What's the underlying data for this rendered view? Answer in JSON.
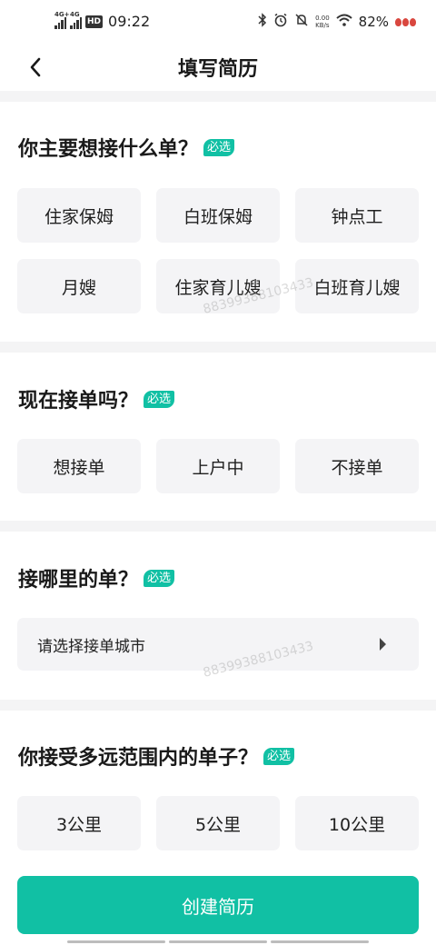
{
  "status_bar": {
    "net1": "4G+",
    "net2": "4G",
    "hd": "HD",
    "time": "09:22",
    "speed": "0.00",
    "speed_unit": "KB/s",
    "battery": "82%"
  },
  "header": {
    "title": "填写简历"
  },
  "required_tag": "必选",
  "sections": {
    "order_type": {
      "title": "你主要想接什么单？",
      "options": [
        "住家保姆",
        "白班保姆",
        "钟点工",
        "月嫂",
        "住家育儿嫂",
        "白班育儿嫂"
      ]
    },
    "accepting": {
      "title": "现在接单吗？",
      "options": [
        "想接单",
        "上户中",
        "不接单"
      ]
    },
    "location": {
      "title": "接哪里的单？",
      "placeholder": "请选择接单城市"
    },
    "range": {
      "title": "你接受多远范围内的单子？",
      "options": [
        "3公里",
        "5公里",
        "10公里"
      ]
    }
  },
  "watermark": "88399388103433",
  "footer": {
    "create_button": "创建简历"
  },
  "colors": {
    "accent": "#11c0a4",
    "option_bg": "#f4f4f6",
    "divider": "#f4f4f5"
  }
}
